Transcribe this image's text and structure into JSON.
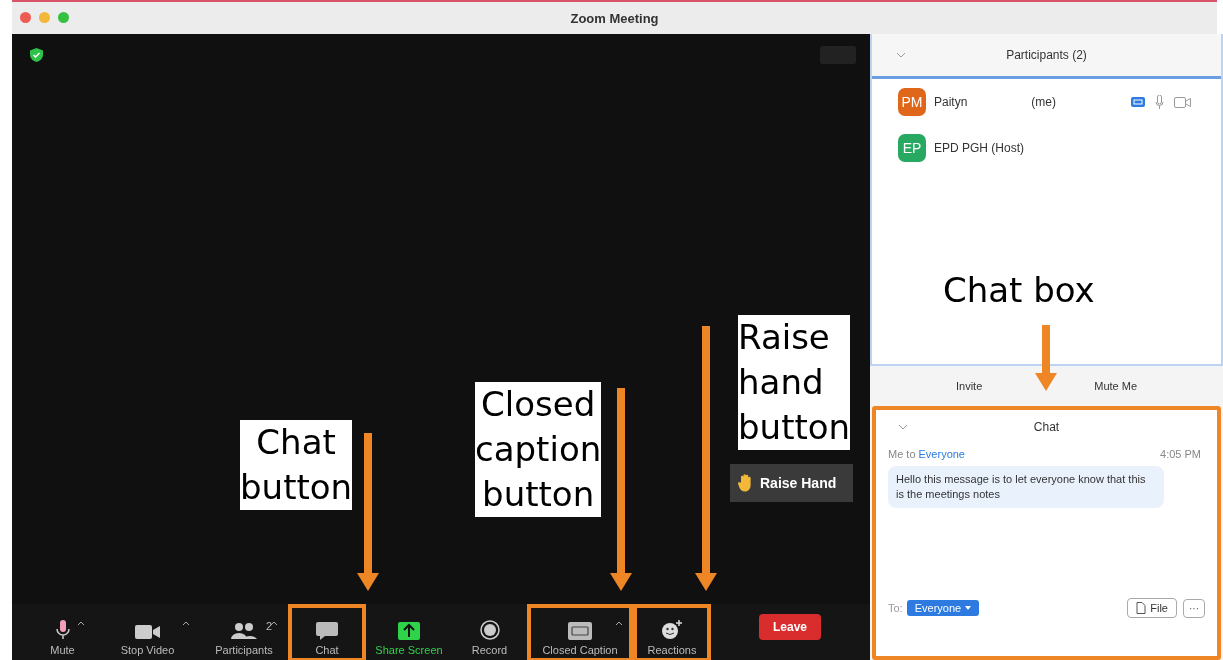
{
  "window": {
    "title": "Zoom Meeting"
  },
  "toolbar": [
    {
      "kind": "mic",
      "label": "Mute",
      "caret": true,
      "highlighted": false
    },
    {
      "kind": "video",
      "label": "Stop Video",
      "caret": true,
      "highlighted": false
    },
    {
      "kind": "participants",
      "label": "Participants",
      "count": "2",
      "caret": true,
      "highlighted": false
    },
    {
      "kind": "chat",
      "label": "Chat",
      "caret": false,
      "highlighted": true
    },
    {
      "kind": "share",
      "label": "Share Screen",
      "caret": false,
      "highlighted": false
    },
    {
      "kind": "record",
      "label": "Record",
      "caret": false,
      "highlighted": false
    },
    {
      "kind": "cc",
      "label": "Closed Caption",
      "caret": true,
      "highlighted": true
    },
    {
      "kind": "reactions",
      "label": "Reactions",
      "caret": false,
      "highlighted": true
    }
  ],
  "leave": "Leave",
  "participants": {
    "title": "Participants (2)",
    "rows": [
      {
        "initials": "PM",
        "color": "#e0661a",
        "name": "Paityn",
        "suffix": "(me)",
        "icons": true
      },
      {
        "initials": "EP",
        "color": "#27a961",
        "name": "EPD PGH (Host)",
        "suffix": null,
        "icons": false
      }
    ],
    "buttons": [
      "Invite",
      "Mute Me"
    ]
  },
  "chat": {
    "title": "Chat",
    "highlighted": true,
    "sender": "Me to",
    "recipient": "Everyone",
    "time": "4:05 PM",
    "message": "Hello this message is to let everyone know that this is the meetings notes",
    "to_label": "To:",
    "to_value": "Everyone",
    "file": "File",
    "more": "···"
  },
  "raise_hand": "Raise Hand",
  "annotations": [
    {
      "lines": [
        "Chat",
        "button"
      ]
    },
    {
      "lines": [
        "Closed",
        "caption",
        "button"
      ]
    },
    {
      "lines": [
        "Raise",
        "hand",
        "button"
      ]
    },
    {
      "lines": [
        "Chat box"
      ]
    }
  ]
}
